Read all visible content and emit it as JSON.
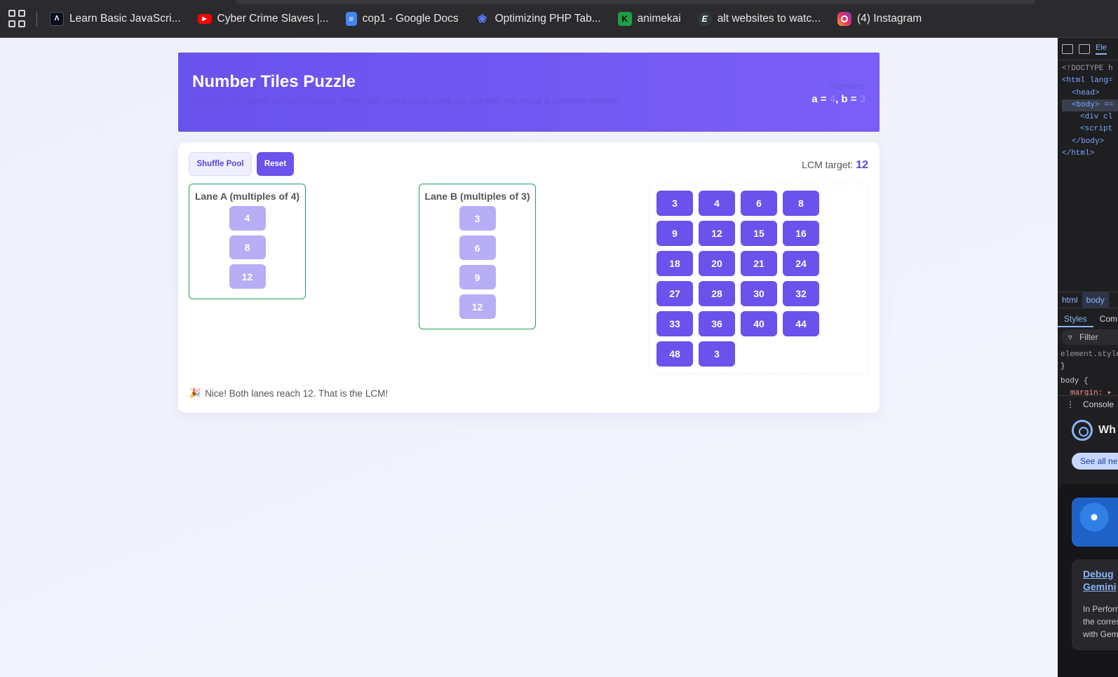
{
  "browser": {
    "bookmarks": [
      {
        "label": "Learn Basic JavaScri...",
        "icon": "code-logo-icon"
      },
      {
        "label": "Cyber Crime Slaves |...",
        "icon": "youtube-icon"
      },
      {
        "label": "cop1 - Google Docs",
        "icon": "google-docs-icon"
      },
      {
        "label": "Optimizing PHP Tab...",
        "icon": "chat-logo-icon"
      },
      {
        "label": "animekai",
        "icon": "animekai-icon"
      },
      {
        "label": "alt websites to watc...",
        "icon": "e-logo-icon"
      },
      {
        "label": "(4) Instagram",
        "icon": "instagram-icon"
      }
    ]
  },
  "header": {
    "title": "Number Tiles Puzzle",
    "subtitle": "Drag tiles into lanes for each number. When both lanes show same top number, you found a common multiple.",
    "numbers_label": "Numbers",
    "a_prefix": "a = ",
    "a_value": "4",
    "b_prefix": ", b = ",
    "b_value": "3"
  },
  "controls": {
    "shuffle_label": "Shuffle Pool",
    "reset_label": "Reset",
    "lcm_label": "LCM target: ",
    "lcm_value": "12"
  },
  "lanes": {
    "a": {
      "title": "Lane A (multiples of 4)",
      "tiles": [
        "4",
        "8",
        "12"
      ]
    },
    "b": {
      "title": "Lane B (multiples of 3)",
      "tiles": [
        "3",
        "6",
        "9",
        "12"
      ]
    }
  },
  "pool": {
    "tiles": [
      "3",
      "4",
      "6",
      "8",
      "9",
      "12",
      "15",
      "16",
      "18",
      "20",
      "21",
      "24",
      "27",
      "28",
      "30",
      "32",
      "33",
      "36",
      "40",
      "44",
      "48",
      "3"
    ]
  },
  "message": {
    "icon": "party-popper-icon",
    "text": "Nice! Both lanes reach 12. That is the LCM!"
  },
  "devtools": {
    "tab": "Ele",
    "code": [
      "<!DOCTYPE h",
      "<html lang=",
      "<head>",
      "<body> ==",
      "<div cl",
      "<script",
      "</body>",
      "</html>"
    ],
    "breadcrumbs": [
      "html",
      "body"
    ],
    "style_tabs": [
      "Styles",
      "Com"
    ],
    "filter": "Filter",
    "styles": [
      "element.style",
      "}",
      "body {",
      "margin: ▸"
    ],
    "console": "Console",
    "whats_new": "Wh",
    "see_all": "See all ne",
    "card_link_1": "Debug",
    "card_link_2": "Gemini",
    "card_text": [
      "In Perform",
      "the corres",
      "with Gem"
    ]
  },
  "colors": {
    "accent": "#6a52ec",
    "lane_border": "#22a05a",
    "lane_tile": "#b7aef6"
  }
}
